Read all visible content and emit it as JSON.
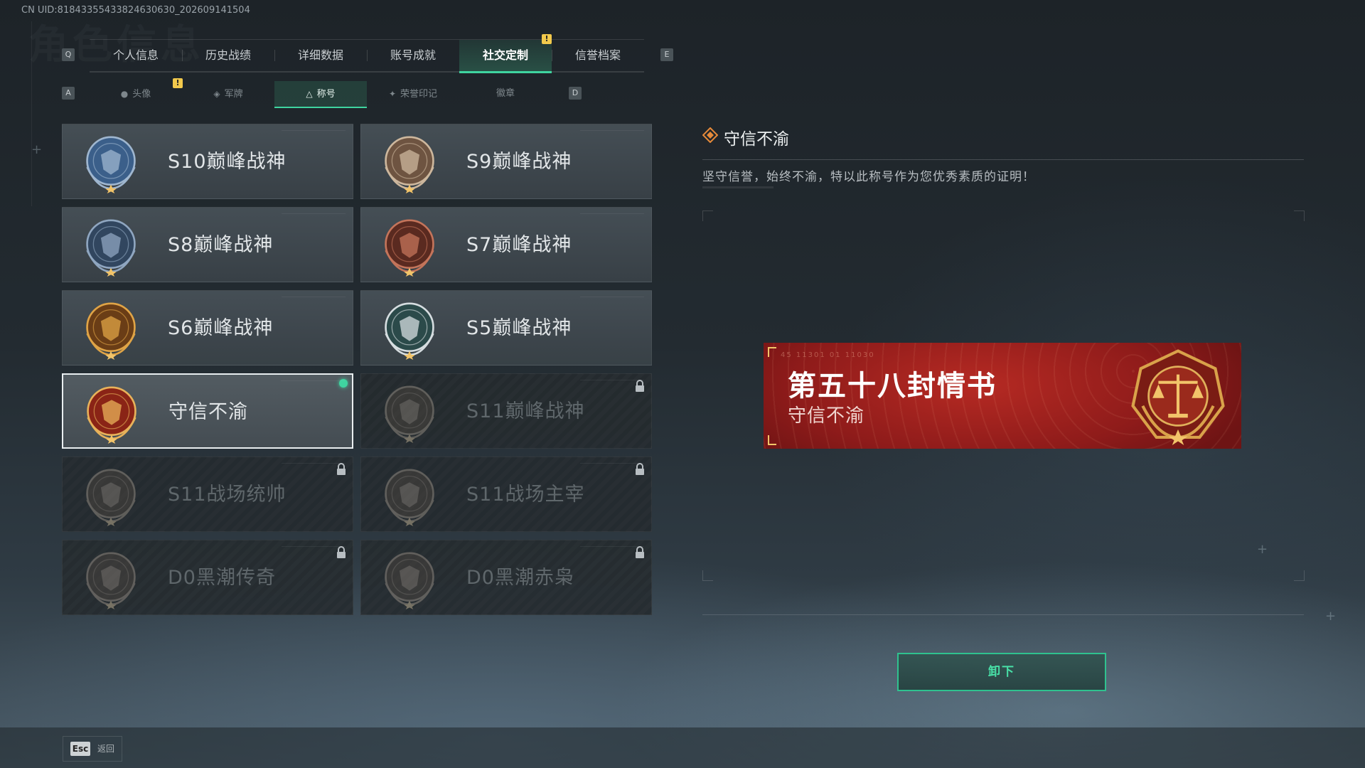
{
  "uid": "CN UID:81843355433824630630_202609141504",
  "page_title_watermark": "角色信息",
  "keys": {
    "prev_tab": "Q",
    "next_tab": "E",
    "prev_sub": "A",
    "next_sub": "D"
  },
  "main_tabs": [
    {
      "label": "个人信息"
    },
    {
      "label": "历史战绩"
    },
    {
      "label": "详细数据"
    },
    {
      "label": "账号成就"
    },
    {
      "label": "社交定制",
      "active": true,
      "notification": "!"
    },
    {
      "label": "信誉档案"
    }
  ],
  "sub_tabs": [
    {
      "label": "头像",
      "icon": "person-icon",
      "notification": "!"
    },
    {
      "label": "军牌",
      "icon": "dogtag-icon"
    },
    {
      "label": "称号",
      "icon": "triangle-icon",
      "active": true
    },
    {
      "label": "荣誉印记",
      "icon": "wings-icon"
    },
    {
      "label": "徽章",
      "icon": ""
    }
  ],
  "titles": [
    {
      "name": "S10巅峰战神",
      "state": "unlocked",
      "badge": "s10-badge-icon"
    },
    {
      "name": "S9巅峰战神",
      "state": "unlocked",
      "badge": "s9-badge-icon"
    },
    {
      "name": "S8巅峰战神",
      "state": "unlocked",
      "badge": "s8-badge-icon"
    },
    {
      "name": "S7巅峰战神",
      "state": "unlocked",
      "badge": "s7-badge-icon"
    },
    {
      "name": "S6巅峰战神",
      "state": "unlocked",
      "badge": "s6-badge-icon"
    },
    {
      "name": "S5巅峰战神",
      "state": "unlocked",
      "badge": "s5-badge-icon"
    },
    {
      "name": "守信不渝",
      "state": "selected",
      "equipped": true,
      "badge": "scales-badge-icon"
    },
    {
      "name": "S11巅峰战神",
      "state": "locked",
      "badge": "s11-badge-icon"
    },
    {
      "name": "S11战场统帅",
      "state": "locked",
      "badge": "tank-badge-icon"
    },
    {
      "name": "S11战场主宰",
      "state": "locked",
      "badge": "arch-badge-icon"
    },
    {
      "name": "D0黑潮传奇",
      "state": "locked",
      "badge": "hood-badge-icon"
    },
    {
      "name": "D0黑潮赤枭",
      "state": "locked",
      "badge": "skull-badge-icon"
    }
  ],
  "detail": {
    "title": "守信不渝",
    "description": "坚守信誉，始终不渝，特以此称号作为您优秀素质的证明！",
    "banner_main": "第五十八封情书",
    "banner_sub": "守信不渝",
    "banner_codes": "45 11301  01 11030"
  },
  "unequip_label": "卸下",
  "footer": {
    "esc_key": "Esc",
    "back_label": "返回"
  },
  "colors": {
    "accent": "#3fd4a0",
    "banner_red": "#b62a23",
    "badge_bronze": "#c07a3a",
    "notification": "#f2c94c"
  }
}
